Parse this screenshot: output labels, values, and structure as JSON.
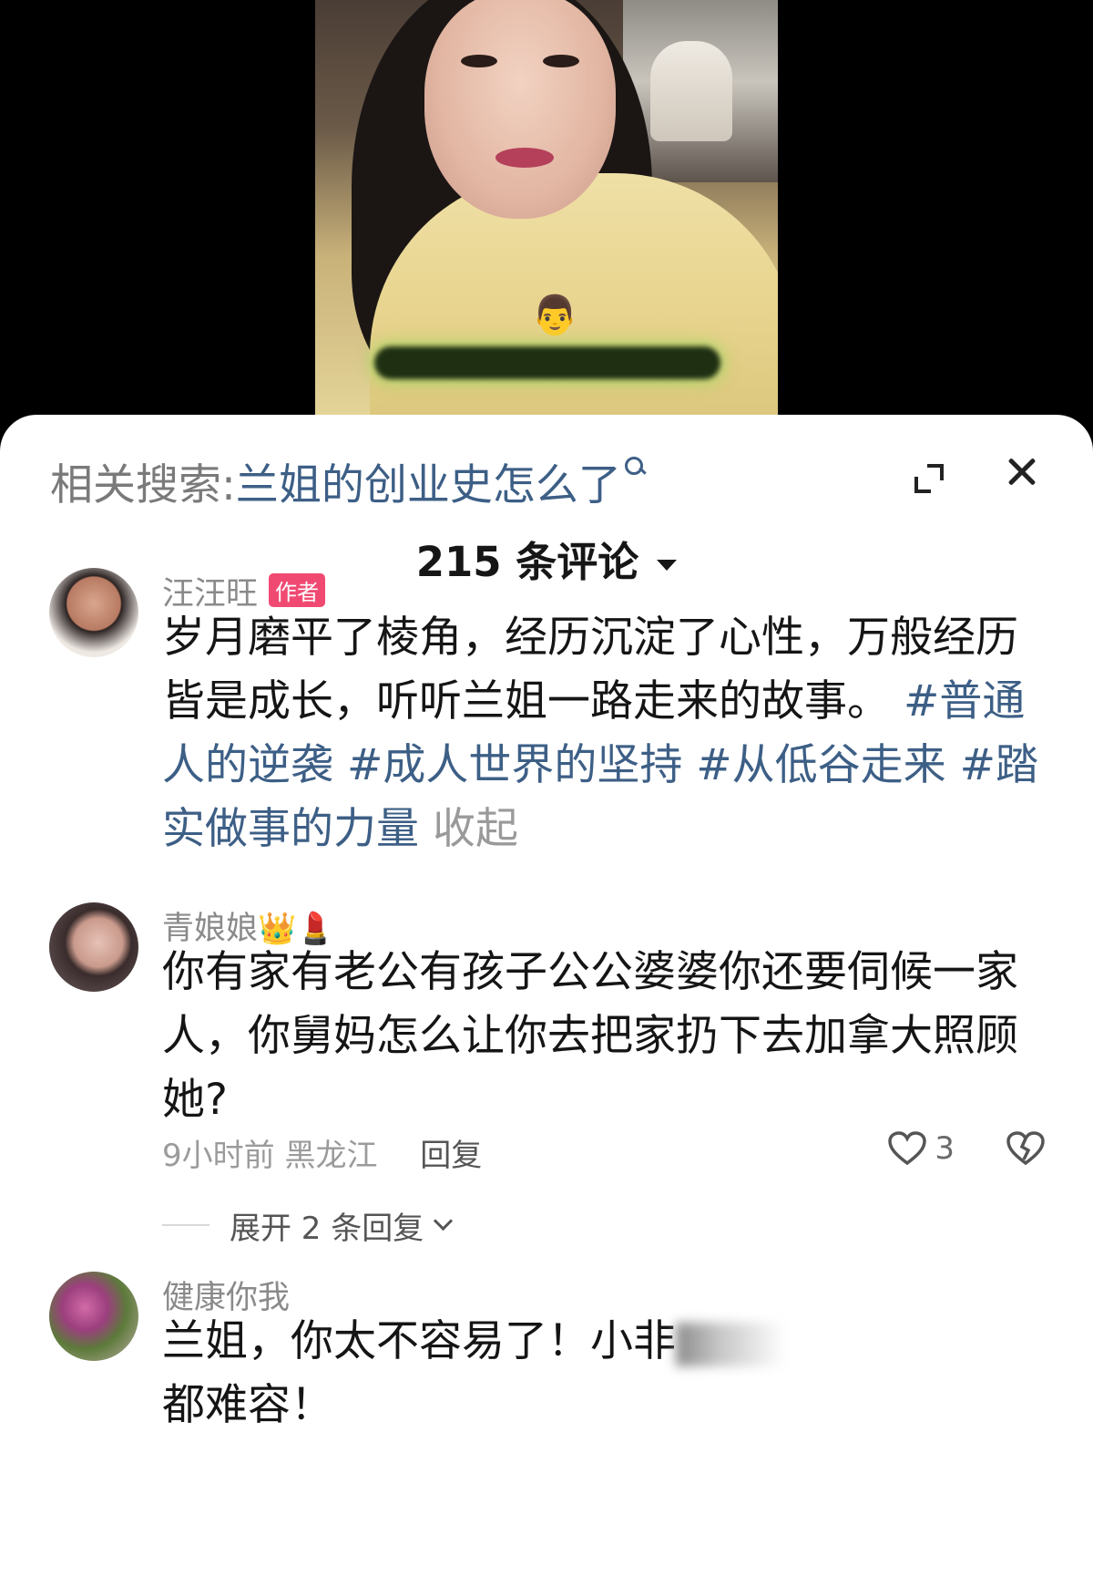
{
  "search": {
    "prefix": "相关搜索:",
    "query": "兰姐的创业史怎么了"
  },
  "comments_header": {
    "count_label": "215 条评论"
  },
  "comments": [
    {
      "username": "汪汪旺",
      "badge": "作者",
      "text": "岁月磨平了棱角，经历沉淀了心性，万般经历皆是成长，听听兰姐一路走来的故事。",
      "hashtags": [
        "#普通人的逆袭",
        "#成人世界的坚持",
        "#从低谷走来",
        "#踏实做事的力量"
      ],
      "collapse_label": "收起"
    },
    {
      "username": "青娘娘",
      "username_emojis": "👑💄",
      "text": "你有家有老公有孩子公公婆婆你还要伺候一家人，你舅妈怎么让你去把家扔下去加拿大照顾她?",
      "time": "9小时前",
      "location": "黑龙江",
      "reply_label": "回复",
      "likes": "3",
      "expand_replies_label": "展开 2 条回复"
    },
    {
      "username": "健康你我",
      "text_line1": "兰姐，你太不容易了！小非",
      "text_line2": "都难容！"
    }
  ],
  "video": {
    "overlay_emoji": "👨"
  },
  "icons": {
    "search": "search-icon",
    "expand": "expand-icon",
    "close": "close-icon",
    "dropdown": "caret-down-icon",
    "like": "heart-icon",
    "dislike": "broken-heart-icon",
    "chevron": "chevron-down-icon"
  },
  "colors": {
    "link_blue": "#3d5f86",
    "author_badge": "#f04a73",
    "muted_text": "#8a8a8a"
  }
}
